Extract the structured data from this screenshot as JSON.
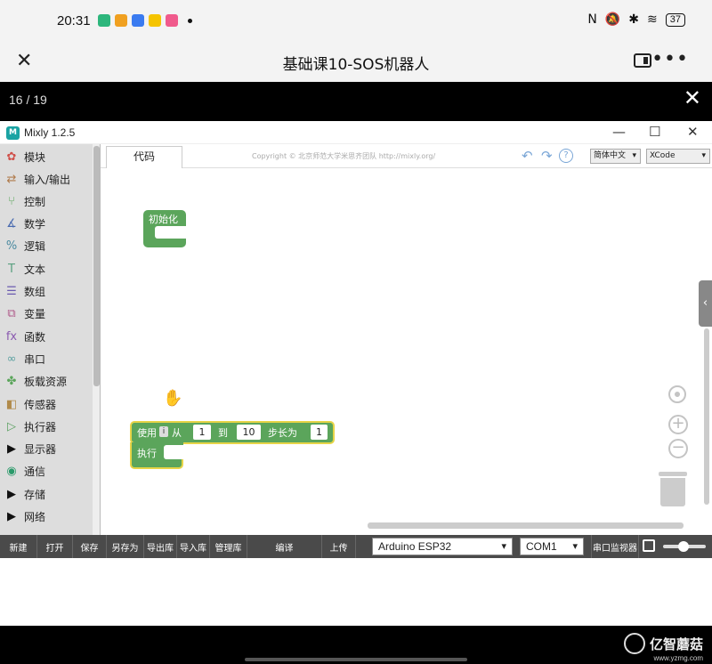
{
  "status_bar": {
    "time": "20:31",
    "app_icons": [
      {
        "name": "app-icon-1",
        "color": "#2db67c"
      },
      {
        "name": "app-icon-2",
        "color": "#f0a020"
      },
      {
        "name": "app-icon-3",
        "color": "#3a7bf0"
      },
      {
        "name": "app-icon-4",
        "color": "#f5c400"
      },
      {
        "name": "app-icon-5",
        "color": "#f05a8c"
      }
    ],
    "nfc": "N",
    "mute": "🔕",
    "bluetooth": "✱",
    "wifi": "≋",
    "battery": "37"
  },
  "app_bar": {
    "title": "基础课10-SOS机器人",
    "close": "✕",
    "more": "•••"
  },
  "viewer": {
    "page_indicator": "16 / 19",
    "close": "✕"
  },
  "window": {
    "title": "Mixly 1.2.5",
    "logo": "M",
    "minimize": "—",
    "maximize": "☐",
    "close": "✕"
  },
  "sidebar": {
    "header": "模块",
    "items": [
      {
        "label": "输入/输出",
        "icon": "io-icon",
        "glyph": "⇄",
        "color": "#b07a4a"
      },
      {
        "label": "控制",
        "icon": "control-icon",
        "glyph": "⑂",
        "color": "#5ba55b"
      },
      {
        "label": "数学",
        "icon": "math-icon",
        "glyph": "∡",
        "color": "#4a6bb0"
      },
      {
        "label": "逻辑",
        "icon": "logic-icon",
        "glyph": "%",
        "color": "#4a8aa0"
      },
      {
        "label": "文本",
        "icon": "text-icon",
        "glyph": "T",
        "color": "#5aa080"
      },
      {
        "label": "数组",
        "icon": "array-icon",
        "glyph": "☰",
        "color": "#6a5ab0"
      },
      {
        "label": "变量",
        "icon": "variable-icon",
        "glyph": "⧉",
        "color": "#b05a8a"
      },
      {
        "label": "函数",
        "icon": "function-icon",
        "glyph": "fx",
        "color": "#8a5ab0"
      },
      {
        "label": "串口",
        "icon": "serial-icon",
        "glyph": "∞",
        "color": "#5aa0a0"
      },
      {
        "label": "板载资源",
        "icon": "board-icon",
        "glyph": "✤",
        "color": "#5ba55b"
      },
      {
        "label": "传感器",
        "icon": "sensor-icon",
        "glyph": "◧",
        "color": "#b08a4a"
      },
      {
        "label": "执行器",
        "icon": "actuator-icon",
        "glyph": "▷",
        "color": "#5aa060"
      },
      {
        "label": "显示器",
        "icon": "display-icon",
        "glyph": "▶",
        "color": "#111111"
      },
      {
        "label": "通信",
        "icon": "comm-icon",
        "glyph": "◉",
        "color": "#2a9a6a"
      },
      {
        "label": "存储",
        "icon": "storage-icon",
        "glyph": "▶",
        "color": "#111111"
      },
      {
        "label": "网络",
        "icon": "network-icon",
        "glyph": "▶",
        "color": "#111111"
      }
    ]
  },
  "workspace": {
    "tab_code": "代码",
    "copyright": "Copyright © 北京师范大学米思齐团队 http://mixly.org/",
    "undo": "↶",
    "redo": "↷",
    "help": "?",
    "language": "简体中文",
    "theme": "XCode"
  },
  "blocks": {
    "init_label": "初始化",
    "for_use": "使用",
    "for_var": "i",
    "for_from": "从",
    "for_from_value": "1",
    "for_to": "到",
    "for_to_value": "10",
    "for_step": "步长为",
    "for_step_value": "1",
    "for_exec": "执行"
  },
  "controls": {
    "side_tab": "‹",
    "zoom_in": "+",
    "zoom_out": "−"
  },
  "toolbar": {
    "buttons": [
      "新建",
      "打开",
      "保存",
      "另存为",
      "导出库",
      "导入库",
      "管理库",
      "编译",
      "上传"
    ],
    "board": "Arduino ESP32",
    "port": "COM1",
    "serial_monitor": "串口监视器"
  },
  "watermark": {
    "text": "亿智蘑菇",
    "url": "www.yzmg.com"
  }
}
